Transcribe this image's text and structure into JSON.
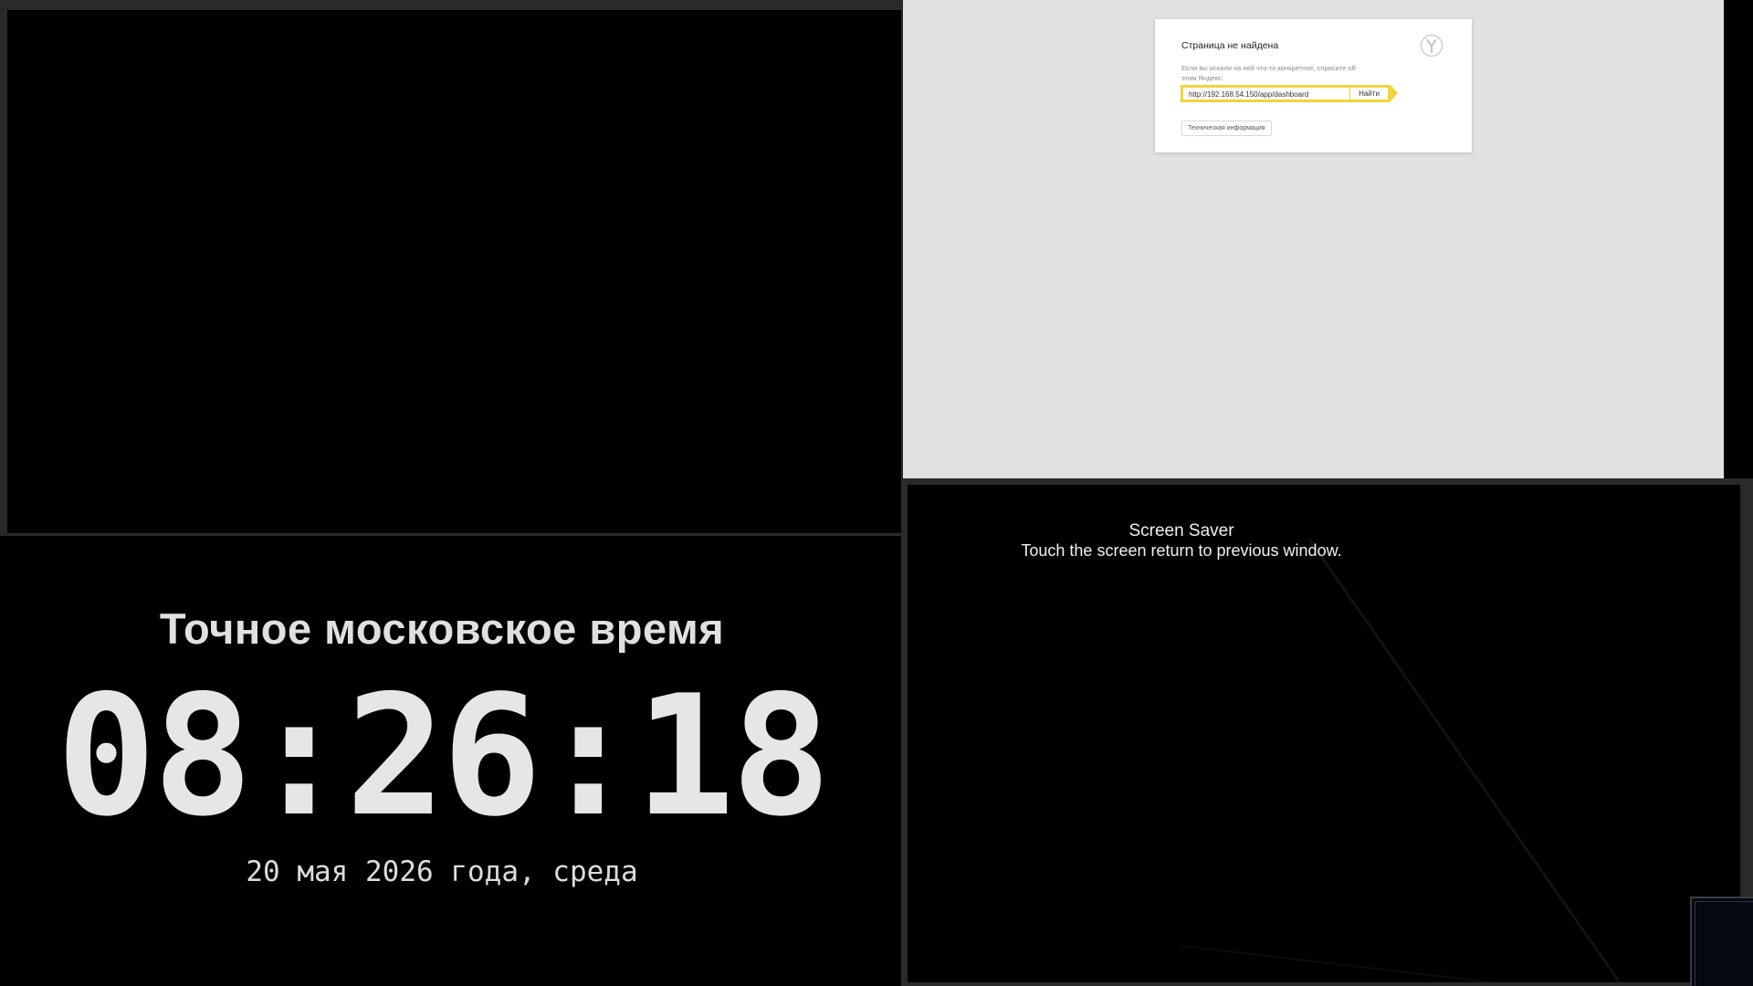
{
  "clock": {
    "title": "Точное московское время",
    "time": "08:26:18",
    "date": "20 мая 2026 года, среда"
  },
  "browser_error": {
    "title": "Страница не найдена",
    "hint": "Если вы искали на ней что-то конкретное, спросите об этом Яндекс:",
    "search_value": "http://192.168.54.150/app/dashboard",
    "search_button_label": "Найти",
    "tech_info_label": "Техническая информация",
    "logo_icon": "yandex-browser-logo-icon",
    "accent_color": "#f2d43c"
  },
  "screen_saver": {
    "title": "Screen Saver",
    "subtitle": "Touch the screen return to previous window."
  }
}
